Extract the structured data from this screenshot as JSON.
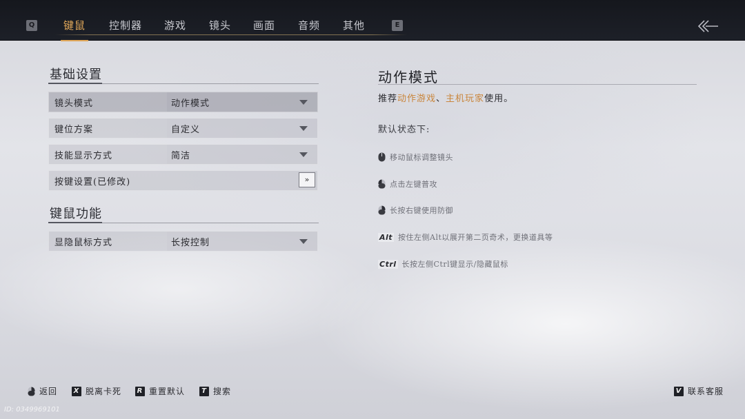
{
  "topbar": {
    "left_key": "Q",
    "right_key": "E",
    "tabs": [
      {
        "label": "键鼠",
        "active": true
      },
      {
        "label": "控制器",
        "active": false
      },
      {
        "label": "游戏",
        "active": false
      },
      {
        "label": "镜头",
        "active": false
      },
      {
        "label": "画面",
        "active": false
      },
      {
        "label": "音频",
        "active": false
      },
      {
        "label": "其他",
        "active": false
      }
    ],
    "back_icon": "back-arrow-icon"
  },
  "basic": {
    "title": "基础设置",
    "rows": [
      {
        "label": "镜头模式",
        "value": "动作模式"
      },
      {
        "label": "键位方案",
        "value": "自定义"
      },
      {
        "label": "技能显示方式",
        "value": "简洁"
      },
      {
        "label": "按键设置(已修改)",
        "button": "»"
      }
    ]
  },
  "mouse": {
    "title": "键鼠功能",
    "rows": [
      {
        "label": "显隐鼠标方式",
        "value": "长按控制"
      }
    ]
  },
  "detail": {
    "title": "动作模式",
    "recommend_prefix": "推荐",
    "recommend_hl1": "动作游戏",
    "recommend_sep": "、",
    "recommend_hl2": "主机玩家",
    "recommend_suffix": "使用。",
    "default_state": "默认状态下:",
    "hints": [
      {
        "icon": "mouse-move-icon",
        "text": "移动鼠标调整镜头"
      },
      {
        "icon": "mouse-left-click-icon",
        "text": "点击左键普攻"
      },
      {
        "icon": "mouse-right-click-icon",
        "text": "长按右键使用防御"
      },
      {
        "key": "Alt",
        "text": "按住左侧Alt以展开第二页奇术，更换道具等"
      },
      {
        "key": "Ctrl",
        "text": "长按左侧Ctrl键显示/隐藏鼠标"
      }
    ]
  },
  "footer": {
    "back": "返回",
    "unstuck_key": "X",
    "unstuck": "脱离卡死",
    "reset_key": "R",
    "reset": "重置默认",
    "search_key": "T",
    "search": "搜索",
    "support_key": "V",
    "support": "联系客服"
  },
  "id_text": "ID: 0349969101",
  "colors": {
    "accent": "#e3a95a",
    "highlight": "#c9853b",
    "topbar": "#1a1c23"
  }
}
